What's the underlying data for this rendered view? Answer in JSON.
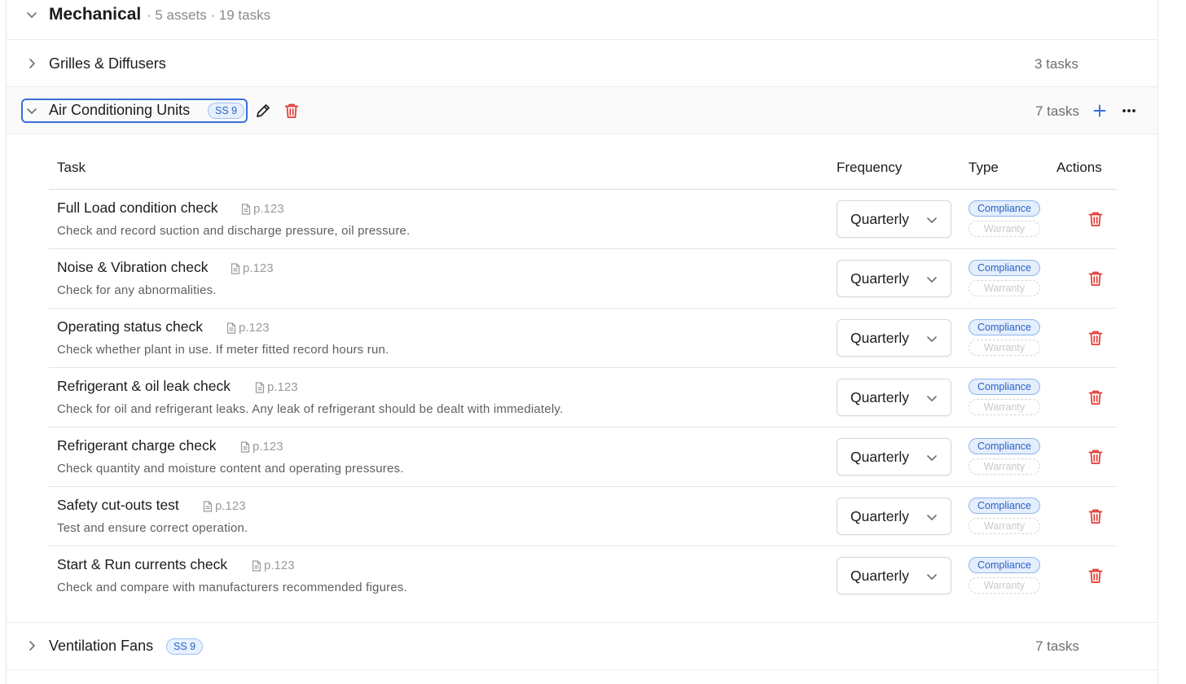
{
  "category": {
    "title": "Mechanical",
    "meta": "· 5 assets · 19 tasks",
    "icon": "chevron-down-icon"
  },
  "groups": {
    "grilles": {
      "title": "Grilles & Diffusers",
      "count": "3 tasks",
      "icon": "chevron-right-icon"
    },
    "ac": {
      "title": "Air Conditioning Units",
      "badge": "SS 9",
      "count": "7 tasks",
      "icon": "chevron-down-icon"
    },
    "fans": {
      "title": "Ventilation Fans",
      "badge": "SS 9",
      "count": "7 tasks",
      "icon": "chevron-right-icon"
    }
  },
  "table": {
    "headers": {
      "task": "Task",
      "frequency": "Frequency",
      "type": "Type",
      "actions": "Actions"
    },
    "rows": [
      {
        "name": "Full Load condition check",
        "page": "p.123",
        "desc": "Check and record suction and discharge pressure, oil pressure.",
        "frequency": "Quarterly",
        "tag1": "Compliance",
        "tag2": "Warranty"
      },
      {
        "name": "Noise & Vibration check",
        "page": "p.123",
        "desc": "Check for any abnormalities.",
        "frequency": "Quarterly",
        "tag1": "Compliance",
        "tag2": "Warranty"
      },
      {
        "name": "Operating status check",
        "page": "p.123",
        "desc": "Check whether plant in use. If meter fitted record hours run.",
        "frequency": "Quarterly",
        "tag1": "Compliance",
        "tag2": "Warranty"
      },
      {
        "name": "Refrigerant & oil leak check",
        "page": "p.123",
        "desc": "Check for oil and refrigerant leaks. Any leak of refrigerant should be dealt with immediately.",
        "frequency": "Quarterly",
        "tag1": "Compliance",
        "tag2": "Warranty"
      },
      {
        "name": "Refrigerant charge check",
        "page": "p.123",
        "desc": "Check quantity and moisture content and operating pressures.",
        "frequency": "Quarterly",
        "tag1": "Compliance",
        "tag2": "Warranty"
      },
      {
        "name": "Safety cut-outs test",
        "page": "p.123",
        "desc": "Test and ensure correct operation.",
        "frequency": "Quarterly",
        "tag1": "Compliance",
        "tag2": "Warranty"
      },
      {
        "name": "Start & Run currents check",
        "page": "p.123",
        "desc": "Check and compare with manufacturers recommended figures.",
        "frequency": "Quarterly",
        "tag1": "Compliance",
        "tag2": "Warranty"
      }
    ]
  },
  "colors": {
    "accent": "#3a6fdc",
    "danger": "#e23b35",
    "muted": "#8a8a8e"
  }
}
